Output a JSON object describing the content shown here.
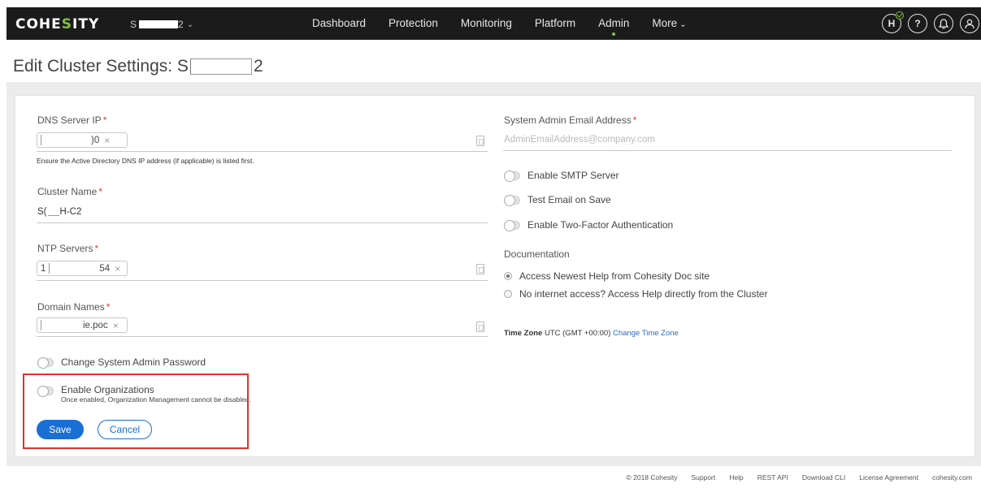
{
  "app": {
    "logo_text_pre": "COHE",
    "logo_text_accent": "S",
    "logo_text_post": "ITY",
    "cluster_name_prefix": "S",
    "cluster_name_suffix": "2"
  },
  "nav": {
    "items": [
      {
        "label": "Dashboard"
      },
      {
        "label": "Protection"
      },
      {
        "label": "Monitoring"
      },
      {
        "label": "Platform"
      },
      {
        "label": "Admin",
        "active": true
      },
      {
        "label": "More"
      }
    ],
    "icons": [
      "helios-icon",
      "help-icon",
      "notifications-icon",
      "user-icon"
    ],
    "helios_letter": "H",
    "help_symbol": "?"
  },
  "page": {
    "title_prefix": "Edit Cluster Settings: S",
    "title_suffix": "2"
  },
  "form": {
    "dns": {
      "label": "DNS Server IP",
      "chip_suffix": ")0",
      "hint": "Ensure the Active Directory DNS IP address (if applicable) is listed first."
    },
    "cluster_name": {
      "label": "Cluster Name",
      "value_prefix": "S(",
      "value_suffix": "H-C2"
    },
    "ntp": {
      "label": "NTP Servers",
      "chip_prefix": "1",
      "chip_suffix": "54"
    },
    "domain": {
      "label": "Domain Names",
      "chip_suffix": "ie.poc"
    },
    "change_password": {
      "label": "Change System Admin Password"
    },
    "organizations": {
      "label": "Enable Organizations",
      "sublabel": "Once enabled, Organization Management cannot be disabled."
    },
    "email": {
      "label": "System Admin Email Address",
      "placeholder": "AdminEmailAddress@company.com"
    },
    "smtp": {
      "label": "Enable SMTP Server"
    },
    "test_email": {
      "label": "Test Email on Save"
    },
    "two_factor": {
      "label": "Enable Two-Factor Authentication"
    },
    "documentation": {
      "label": "Documentation",
      "options": [
        {
          "label": "Access Newest Help from Cohesity Doc site",
          "selected": true
        },
        {
          "label": "No internet access? Access Help directly from the Cluster",
          "selected": false
        }
      ]
    },
    "timezone": {
      "label": "Time Zone",
      "value": "UTC (GMT +00:00)",
      "change_link": "Change Time Zone"
    },
    "remove_symbol": "×",
    "save_label": "Save",
    "cancel_label": "Cancel"
  },
  "footer": {
    "links": [
      "© 2018 Cohesity",
      "Support",
      "Help",
      "REST API",
      "Download CLI",
      "License Agreement",
      "cohesity.com"
    ]
  },
  "colors": {
    "nav_bg": "#1b1b1b",
    "accent_green": "#7fc241",
    "primary_blue": "#1a6fd4",
    "highlight_red": "#e0332a"
  }
}
